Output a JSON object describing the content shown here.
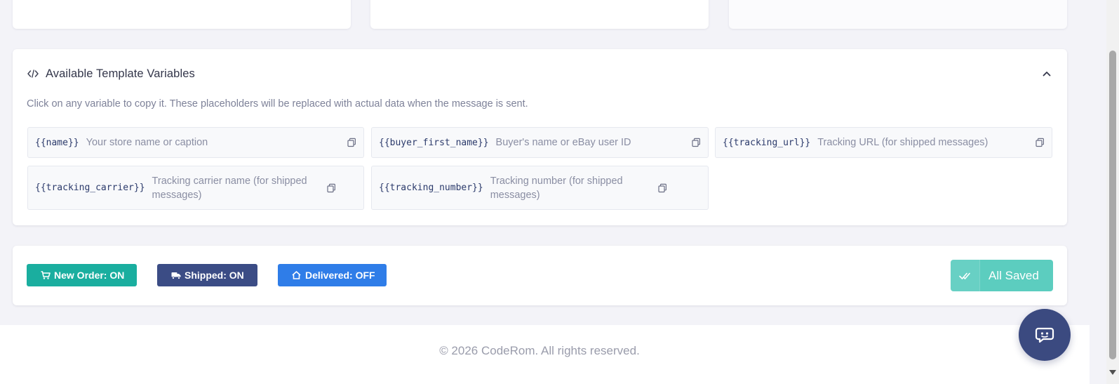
{
  "variables_panel": {
    "title": "Available Template Variables",
    "description": "Click on any variable to copy it. These placeholders will be replaced with actual data when the message is sent.",
    "items": [
      {
        "code": "{{name}}",
        "desc": "Your store name or caption"
      },
      {
        "code": "{{buyer_first_name}}",
        "desc": "Buyer's name or eBay user ID"
      },
      {
        "code": "{{tracking_url}}",
        "desc": "Tracking URL (for shipped messages)"
      },
      {
        "code": "{{tracking_carrier}}",
        "desc": "Tracking carrier name (for shipped messages)"
      },
      {
        "code": "{{tracking_number}}",
        "desc": "Tracking number (for shipped messages)"
      }
    ]
  },
  "status_bar": {
    "new_order": "New Order: ON",
    "shipped": "Shipped: ON",
    "delivered": "Delivered: OFF",
    "saved_label": "All Saved"
  },
  "footer": {
    "copyright": "© 2026 CodeRom. All rights reserved."
  },
  "colors": {
    "new_order": "#1aae9f",
    "shipped": "#3b4c85",
    "delivered": "#2f7de8",
    "saved": "#5ccdbf",
    "chat": "#3b4a80"
  },
  "icons": {
    "header": "code-icon",
    "collapse": "chevron-up-icon",
    "copy": "copy-icon",
    "new_order": "cart-icon",
    "shipped": "truck-icon",
    "delivered": "home-icon",
    "saved": "double-check-icon",
    "chat": "chat-bot-icon"
  }
}
